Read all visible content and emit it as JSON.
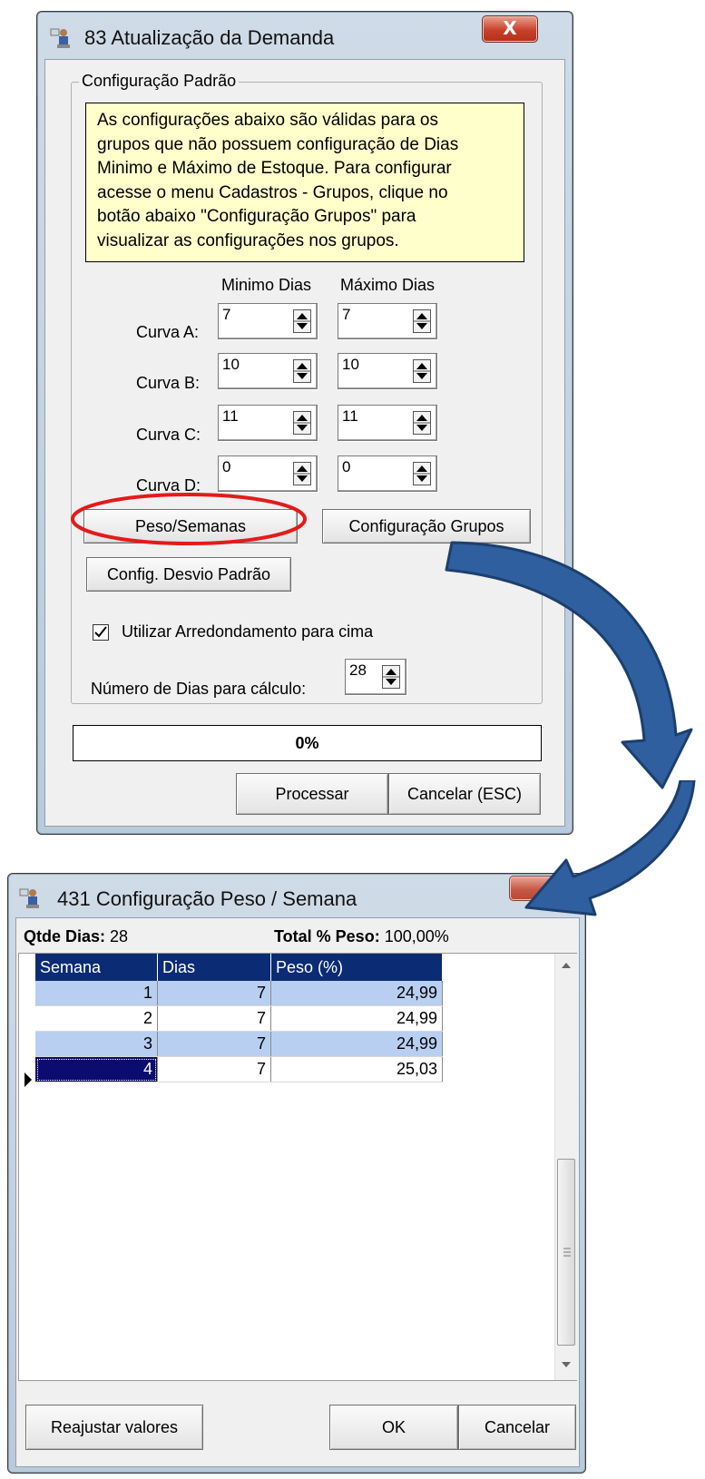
{
  "dialog1": {
    "title": "83 Atualização da Demanda",
    "close_label": "X",
    "group_title": "Configuração Padrão",
    "note_lines": [
      "As configurações abaixo são válidas para os",
      "grupos que não possuem configuração de Dias",
      "Minimo e Máximo de Estoque. Para configurar",
      "acesse o menu Cadastros - Grupos, clique no",
      "botão abaixo \"Configuração Grupos\" para",
      "visualizar as configurações nos grupos."
    ],
    "col_min": "Minimo Dias",
    "col_max": "Máximo Dias",
    "curves": [
      {
        "label": "Curva A:",
        "min": "7",
        "max": "7"
      },
      {
        "label": "Curva B:",
        "min": "10",
        "max": "10"
      },
      {
        "label": "Curva C:",
        "min": "11",
        "max": "11"
      },
      {
        "label": "Curva D:",
        "min": "0",
        "max": "0"
      }
    ],
    "peso_semanas_button": "Peso/Semanas",
    "config_grupos_button": "Configuração Grupos",
    "desvio_button": "Config. Desvio Padrão",
    "round_up_label": "Utilizar Arredondamento para cima",
    "round_up_checked": true,
    "num_dias_label": "Número de Dias para cálculo:",
    "num_dias_value": "28",
    "progress_text": "0%",
    "progress_value": 0,
    "processar_button": "Processar",
    "cancelar_button": "Cancelar (ESC)",
    "highlight_color": "#e21b1b"
  },
  "dialog2": {
    "title": "431 Configuração Peso / Semana",
    "qtde_label": "Qtde Dias:",
    "qtde_value": "28",
    "total_label": "Total % Peso:",
    "total_value": "100,00%",
    "columns": [
      "Semana",
      "Dias",
      "Peso (%)"
    ],
    "rows": [
      {
        "semana": "1",
        "dias": "7",
        "peso": "24,99"
      },
      {
        "semana": "2",
        "dias": "7",
        "peso": "24,99"
      },
      {
        "semana": "3",
        "dias": "7",
        "peso": "24,99"
      },
      {
        "semana": "4",
        "dias": "7",
        "peso": "25,03"
      }
    ],
    "reajustar_button": "Reajustar valores",
    "ok_button": "OK",
    "cancelar_button": "Cancelar",
    "header_color": "#0b2b74",
    "alt_row_color": "#b9cff1"
  },
  "arrow_color": "#2f5f9e"
}
